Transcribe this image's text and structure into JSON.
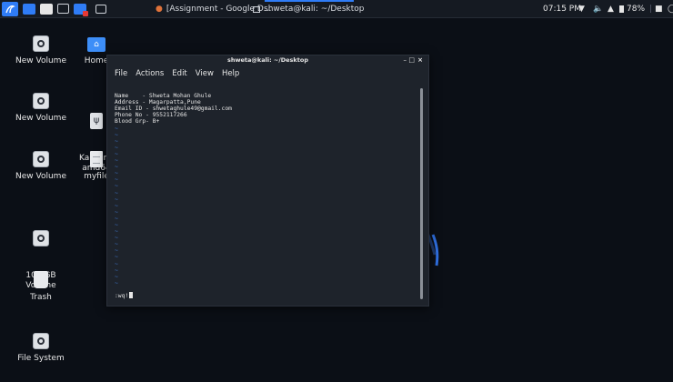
{
  "panel": {
    "tasks": [
      {
        "label": "[Assignment - Google D...",
        "icon": "browser-icon"
      },
      {
        "label": "shweta@kali: ~/Desktop",
        "icon": "terminal-icon"
      }
    ],
    "clock": "07:15 PM",
    "battery": "78%"
  },
  "desktop": {
    "icons": [
      {
        "label": "New Volume"
      },
      {
        "label": "Home"
      },
      {
        "label": "New Volume"
      },
      {
        "label": "Kali Linu\namd64"
      },
      {
        "label": "New Volume"
      },
      {
        "label": "myfile"
      },
      {
        "label": "104 GB\nVolume"
      },
      {
        "label": "Trash"
      },
      {
        "label": "File System"
      }
    ]
  },
  "terminal": {
    "title": "shweta@kali: ~/Desktop",
    "menu": [
      "File",
      "Actions",
      "Edit",
      "View",
      "Help"
    ],
    "lines": [
      "Name    - Shweta Mohan Ghule",
      "Address - Magarpatta,Pune",
      "Email ID - shwetaghule49@gmail.com",
      "Phone No - 9552117266",
      "Blood Grp- B+"
    ],
    "command": ":wq!"
  },
  "colors": {
    "accent": "#2f7cf6",
    "terminal_bg": "#1e232b",
    "vim_tilde": "#3d74c8"
  }
}
